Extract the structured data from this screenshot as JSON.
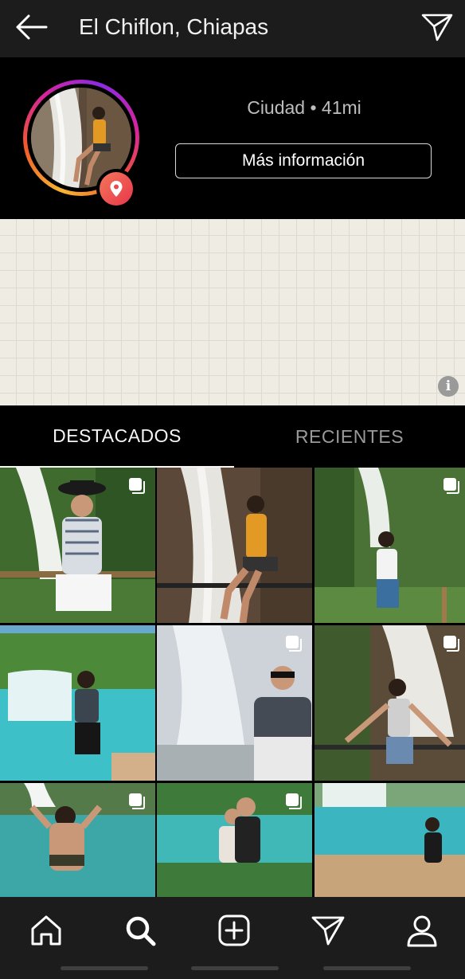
{
  "topbar": {
    "back_icon": "arrow-left-icon",
    "title": "El Chiflon, Chiapas",
    "send_icon": "paper-plane-icon"
  },
  "header": {
    "avatar_icon": "location-pin-icon",
    "meta": "Ciudad • 41mi",
    "more_button": "Más información"
  },
  "map": {
    "info_label": "i"
  },
  "tabs": [
    {
      "label": "DESTACADOS",
      "active": true
    },
    {
      "label": "RECIENTES",
      "active": false
    }
  ],
  "grid": {
    "posts": [
      {
        "multi": true
      },
      {
        "multi": false
      },
      {
        "multi": true
      },
      {
        "multi": false
      },
      {
        "multi": true
      },
      {
        "multi": true
      },
      {
        "multi": true
      },
      {
        "multi": true
      },
      {
        "multi": false
      }
    ]
  },
  "bottom_nav": [
    {
      "icon": "home-icon"
    },
    {
      "icon": "search-icon"
    },
    {
      "icon": "add-post-icon"
    },
    {
      "icon": "direct-send-icon"
    },
    {
      "icon": "profile-icon"
    }
  ],
  "colors": {
    "bar": "#1c1c1c",
    "background": "#000000",
    "map": "#efece4",
    "ring_gradient": [
      "#f7b733",
      "#f1592a",
      "#d6249f"
    ]
  }
}
